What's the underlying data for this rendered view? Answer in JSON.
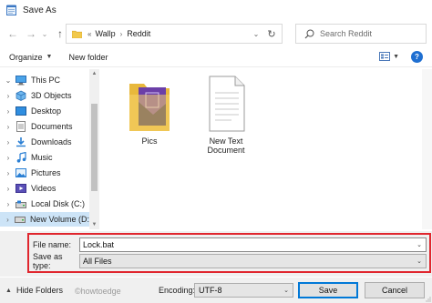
{
  "window": {
    "title": "Save As"
  },
  "nav": {
    "breadcrumb_prefix": "«",
    "breadcrumb": [
      "Wallp",
      "Reddit"
    ],
    "search_placeholder": "Search Reddit"
  },
  "toolbar": {
    "organize_label": "Organize",
    "new_folder_label": "New folder",
    "help_label": "?"
  },
  "sidebar": {
    "items": [
      {
        "label": "This PC",
        "icon": "pc-icon",
        "expander": "⌄",
        "selected": false
      },
      {
        "label": "3D Objects",
        "icon": "3d-objects-icon",
        "expander": "›",
        "selected": false
      },
      {
        "label": "Desktop",
        "icon": "desktop-icon",
        "expander": "›",
        "selected": false
      },
      {
        "label": "Documents",
        "icon": "documents-icon",
        "expander": "›",
        "selected": false
      },
      {
        "label": "Downloads",
        "icon": "downloads-icon",
        "expander": "›",
        "selected": false
      },
      {
        "label": "Music",
        "icon": "music-icon",
        "expander": "›",
        "selected": false
      },
      {
        "label": "Pictures",
        "icon": "pictures-icon",
        "expander": "›",
        "selected": false
      },
      {
        "label": "Videos",
        "icon": "videos-icon",
        "expander": "›",
        "selected": false
      },
      {
        "label": "Local Disk (C:)",
        "icon": "local-disk-icon",
        "expander": "›",
        "selected": false
      },
      {
        "label": "New Volume (D:",
        "icon": "drive-icon",
        "expander": "›",
        "selected": true
      }
    ]
  },
  "files": [
    {
      "name": "Pics",
      "kind": "folder"
    },
    {
      "name": "New Text Document",
      "kind": "text"
    }
  ],
  "form": {
    "file_name_label": "File name:",
    "file_name_value": "Lock.bat",
    "save_type_label": "Save as type:",
    "save_type_value": "All Files"
  },
  "bottom": {
    "hide_folders_label": "Hide Folders",
    "watermark": "©howtoedge",
    "encoding_label": "Encoding:",
    "encoding_value": "UTF-8",
    "save_label": "Save",
    "cancel_label": "Cancel"
  },
  "colors": {
    "highlight_outline": "#e0262e",
    "selection": "#cde4f7",
    "accent": "#0078d7"
  }
}
